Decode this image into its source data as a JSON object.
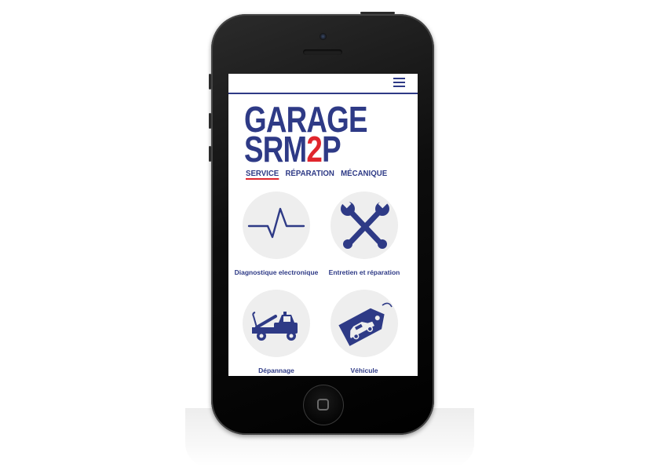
{
  "header": {
    "menu_icon": "hamburger-menu-icon"
  },
  "logo": {
    "line1": "GARAGE",
    "line2_prefix": "SRM",
    "line2_accent": "2",
    "line2_suffix": "P",
    "tagline": [
      "SERVICE",
      "RÉPARATION",
      "MÉCANIQUE"
    ],
    "colors": {
      "primary": "#2e3a86",
      "accent": "#e0262d"
    }
  },
  "services": [
    {
      "label": "Diagnostique electronique",
      "icon": "pulse-line-icon"
    },
    {
      "label": "Entretien et réparation",
      "icon": "crossed-wrenches-icon"
    },
    {
      "label": "Dépannage",
      "icon": "tow-truck-icon"
    },
    {
      "label": "Véhicule",
      "icon": "car-price-tag-icon"
    }
  ]
}
